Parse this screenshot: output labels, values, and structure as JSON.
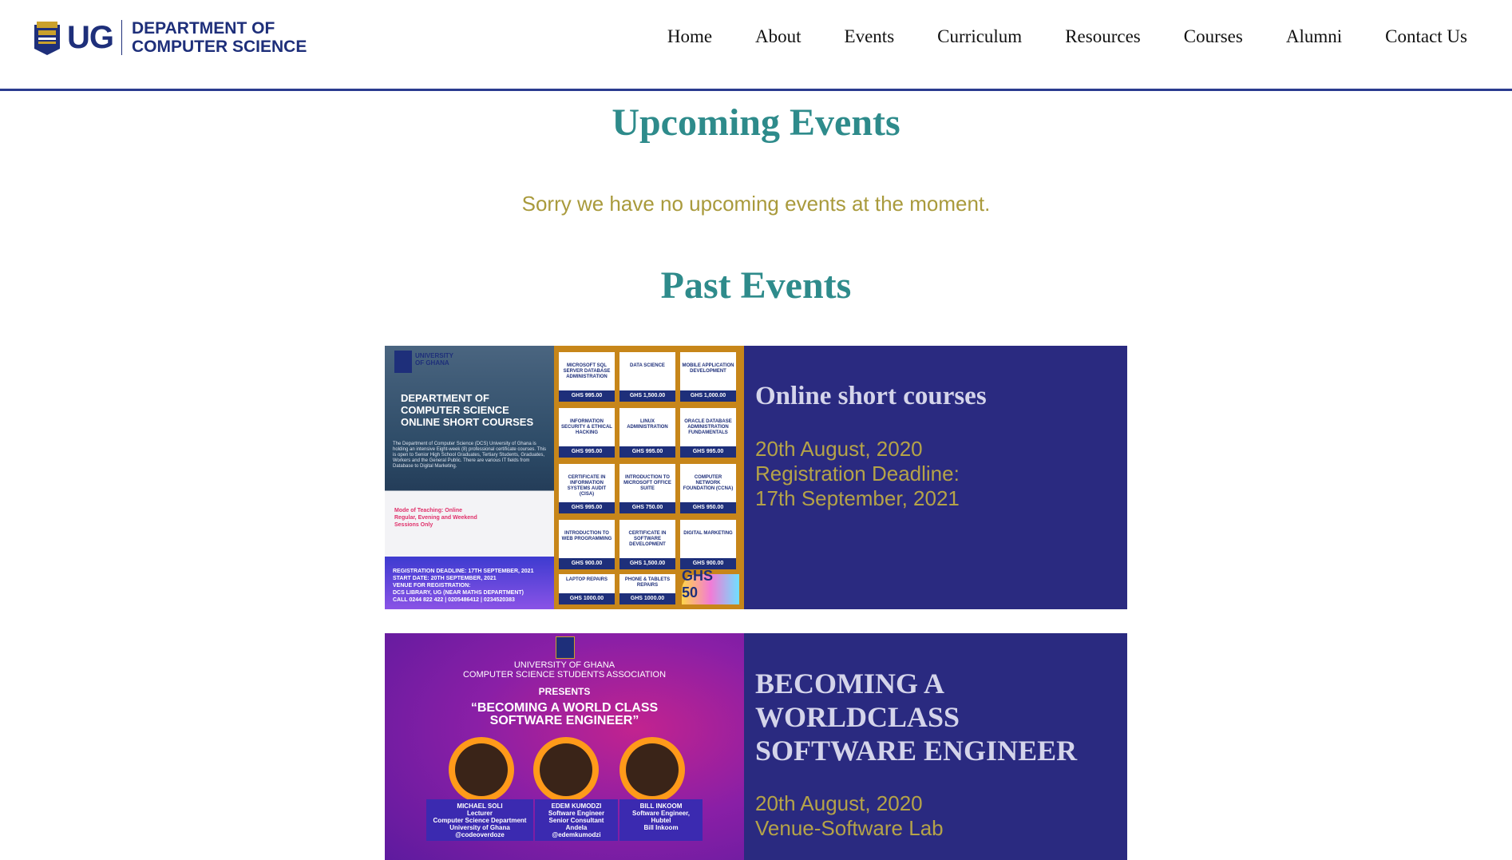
{
  "header": {
    "logo_abbr": "UG",
    "dept_line1": "DEPARTMENT OF",
    "dept_line2": "COMPUTER SCIENCE",
    "nav": [
      "Home",
      "About",
      "Events",
      "Curriculum",
      "Resources",
      "Courses",
      "Alumni",
      "Contact Us"
    ]
  },
  "upcoming": {
    "title": "Upcoming Events",
    "message": "Sorry we have no upcoming events at the moment."
  },
  "past": {
    "title": "Past Events",
    "events": [
      {
        "title": "Online short courses",
        "lines": [
          "20th August, 2020",
          "Registration Deadline:",
          "17th September, 2021"
        ],
        "poster": {
          "brand": "UNIVERSITY OF GHANA",
          "heading": [
            "DEPARTMENT OF",
            "COMPUTER SCIENCE",
            "ONLINE SHORT COURSES"
          ],
          "blurb": "The Department of Computer Science (DCS) University of Ghana is holding an intensive Eight-week (8) professional certificate courses. This is open to Senior High School Graduates, Tertiary Students, Graduates, Workers and the General Public. There are various IT fields from Database to Digital Marketing.",
          "mode": [
            "Mode of Teaching: Online",
            "Regular, Evening and Weekend",
            "Sessions Only"
          ],
          "dates": [
            "REGISTRATION DEADLINE: 17TH SEPTEMBER, 2021",
            "START DATE: 20TH SEPTEMBER, 2021"
          ],
          "venue": [
            "VENUE FOR REGISTRATION:",
            "DCS LIBRARY, UG (NEAR MATHS DEPARTMENT)"
          ],
          "contact": "CALL 0244 822 422 | 0205486412 | 0234520383",
          "courses": [
            {
              "name": "MICROSOFT SQL SERVER DATABASE ADMINISTRATION",
              "price": "GHS 995.00"
            },
            {
              "name": "DATA SCIENCE",
              "price": "GHS 1,500.00"
            },
            {
              "name": "MOBILE APPLICATION DEVELOPMENT",
              "price": "GHS 1,000.00"
            },
            {
              "name": "INFORMATION SECURITY & ETHICAL HACKING",
              "price": "GHS 995.00"
            },
            {
              "name": "LINUX ADMINISTRATION",
              "price": "GHS 995.00"
            },
            {
              "name": "ORACLE DATABASE ADMINISTRATION FUNDAMENTALS",
              "price": "GHS 995.00"
            },
            {
              "name": "CERTIFICATE IN INFORMATION SYSTEMS AUDIT (CISA)",
              "price": "GHS 995.00"
            },
            {
              "name": "INTRODUCTION TO MICROSOFT OFFICE SUITE",
              "price": "GHS 750.00"
            },
            {
              "name": "COMPUTER NETWORK FOUNDATION (CCNA)",
              "price": "GHS 950.00"
            },
            {
              "name": "INTRODUCTION TO WEB PROGRAMMING",
              "price": "GHS 900.00"
            },
            {
              "name": "CERTIFICATE IN SOFTWARE DEVELOPMENT",
              "price": "GHS 1,500.00"
            },
            {
              "name": "DIGITAL MARKETING",
              "price": "GHS 900.00"
            },
            {
              "name": "LAPTOP REPAIRS",
              "price": "GHS 1000.00"
            },
            {
              "name": "PHONE & TABLETS REPAIRS",
              "price": "GHS 1000.00"
            }
          ],
          "reg_fee": "GHS 50"
        }
      },
      {
        "title": "BECOMING A WORLDCLASS SOFTWARE ENGINEER",
        "lines": [
          "20th August, 2020",
          "Venue-Software Lab"
        ],
        "poster": {
          "org1": "UNIVERSITY OF GHANA",
          "org2": "COMPUTER SCIENCE STUDENTS ASSOCIATION",
          "presents": "PRESENTS",
          "talk": [
            "“BECOMING A WORLD CLASS",
            "SOFTWARE ENGINEER”"
          ],
          "speakers": [
            {
              "name": "MICHAEL SOLI",
              "role": "Lecturer",
              "org": "Computer Science Department",
              "org2": "University of Ghana",
              "handle": "@codeoverdoze"
            },
            {
              "name": "EDEM KUMODZI",
              "role": "Software Engineer",
              "org": "Senior Consultant",
              "org2": "Andela",
              "handle": "@edemkumodzi"
            },
            {
              "name": "BILL INKOOM",
              "role": "Software Engineer,",
              "org": "Hubtel",
              "org2": "",
              "handle": "Bill Inkoom"
            }
          ]
        }
      }
    ]
  }
}
